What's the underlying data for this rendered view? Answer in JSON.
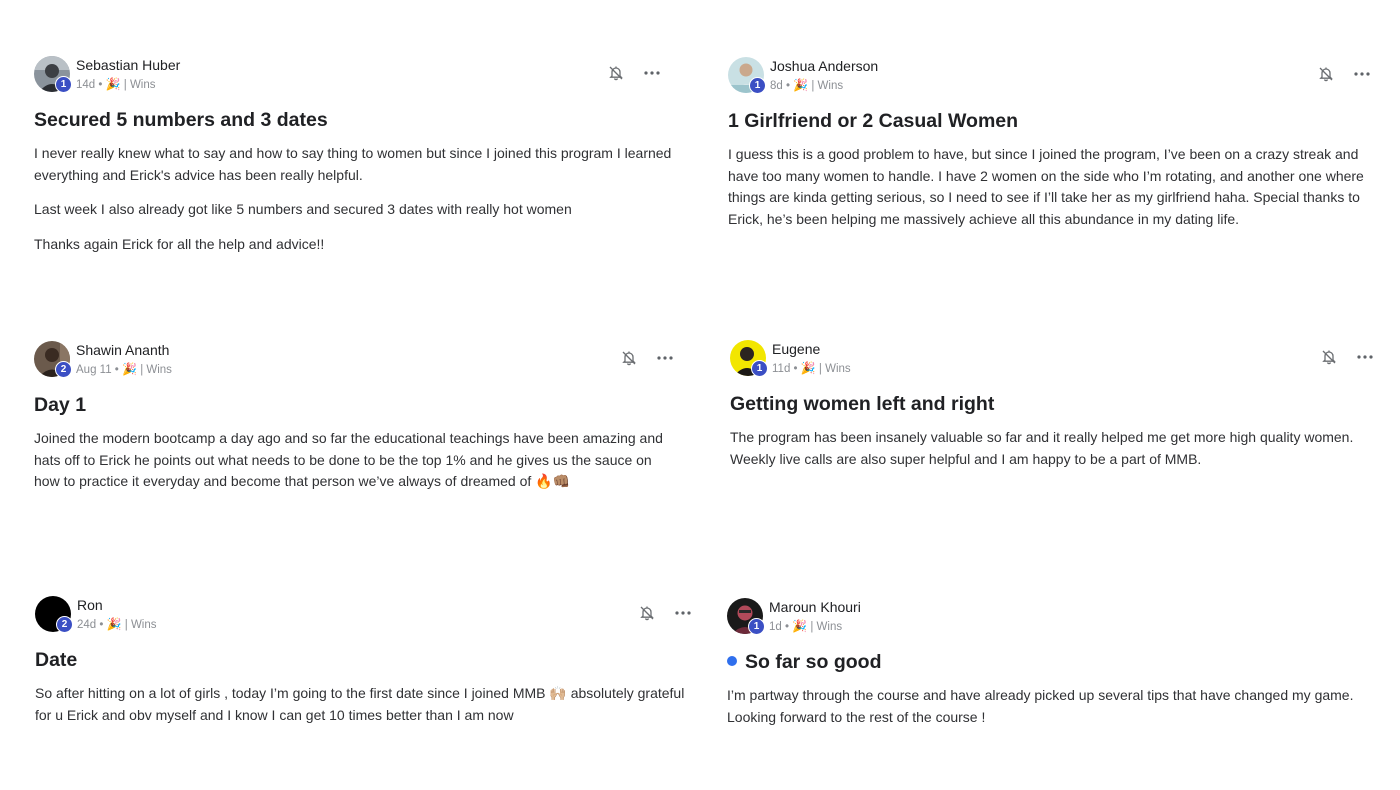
{
  "posts": [
    {
      "author": "Sebastian Huber",
      "level": "1",
      "time": "14d",
      "category": "| Wins",
      "title": "Secured 5 numbers and 3 dates",
      "paragraphs": [
        "I never really knew what to say and how to say thing to women but since I joined this program I learned everything and Erick's advice has been really helpful.",
        "Last week I also already got like 5 numbers and secured 3 dates with really hot women",
        "Thanks again Erick for all the help and advice!!"
      ],
      "avatar_color": "#6d7680"
    },
    {
      "author": "Joshua Anderson",
      "level": "1",
      "time": "8d",
      "category": "| Wins",
      "title": "1 Girlfriend or 2 Casual Women",
      "paragraphs": [
        "I guess this is a good problem to have, but since I joined the program, I’ve been on a crazy streak and have too many women to handle. I have 2 women on the side who I’m rotating, and another one where things are kinda getting serious, so I need to see if I’ll take her as my girlfriend haha. Special thanks to Erick, he’s been helping me massively achieve all this abundance in my dating life."
      ],
      "avatar_color": "#9fc4cc"
    },
    {
      "author": "Shawin Ananth",
      "level": "2",
      "time": "Aug 11",
      "category": "| Wins",
      "title": "Day 1",
      "paragraphs": [
        "Joined the modern bootcamp a day ago and so far the educational teachings have been amazing and hats off to Erick he points out what needs to be done to be the top 1% and he gives us the sauce on how to practice it everyday and become that person we’ve always of dreamed of 🔥👊🏽"
      ],
      "avatar_color": "#5a4a3e"
    },
    {
      "author": "Eugene",
      "level": "1",
      "time": "11d",
      "category": "| Wins",
      "title": "Getting women left and right",
      "paragraphs": [
        "The program has been insanely valuable so far and it really helped me get more high quality women. Weekly live calls are also super helpful and I am happy to be a part of MMB."
      ],
      "avatar_color": "#f2e600"
    },
    {
      "author": "Ron",
      "level": "2",
      "time": "24d",
      "category": "| Wins",
      "title": "Date",
      "paragraphs": [
        "So after hitting on a lot of girls , today I’m going to the first date since I joined MMB 🙌🏼 absolutely grateful for u Erick and obv myself and I know I can get 10 times better than I am now"
      ],
      "avatar_color": "#000000"
    },
    {
      "author": "Maroun Khouri",
      "level": "1",
      "time": "1d",
      "category": "| Wins",
      "title": "So far so good",
      "paragraphs": [
        "I’m partway through the course and have already picked up several tips that have changed my game. Looking forward to the rest of the course !"
      ],
      "avatar_color": "#1a1a1a",
      "unread": true,
      "unread_color": "#2f6fed"
    }
  ],
  "icons": {
    "bell": "bell-off-icon",
    "more": "more-horizontal-icon",
    "party": "party-popper-icon"
  },
  "colors": {
    "level_badge": "#3b4fc4",
    "meta_text": "#8c8f94"
  }
}
